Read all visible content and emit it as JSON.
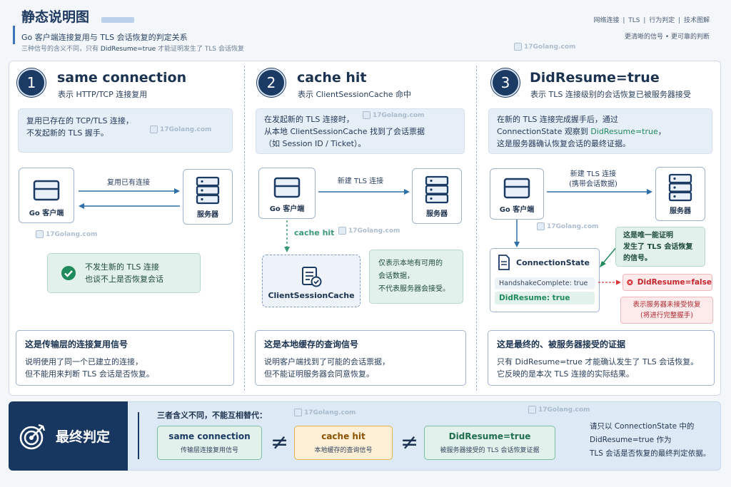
{
  "header": {
    "title": "静态说明图",
    "subtitle": "Go 客户端连接复用与 TLS 会话恢复的判定关系",
    "subnote_pre": "三种信号的含义不同，只有",
    "subnote_key": "DidResume=true",
    "subnote_post": "才能证明发生了 TLS 会话恢复",
    "tags": "网络连接 | TLS | 行为判定 | 技术图解",
    "tags2": "更清晰的信号   •   更可靠的判断"
  },
  "watermark": "17Golang.com",
  "columns": [
    {
      "num": "1",
      "title": "same connection",
      "subtitle": "表示 HTTP/TCP 连接复用",
      "desc_lines": [
        "复用已存在的 TCP/TLS 连接，",
        "不发起新的 TLS 握手。"
      ],
      "client_label": "Go 客户端",
      "server_label": "服务器",
      "arrow_label": "复用已有连接",
      "check_lines": [
        "不发生新的 TLS 连接",
        "也谈不上是否恢复会话"
      ],
      "bottom_title": "这是传输层的连接复用信号",
      "bottom_lines": [
        "说明使用了同一个已建立的连接，",
        "但不能用来判断 TLS 会话是否恢复。"
      ]
    },
    {
      "num": "2",
      "title": "cache hit",
      "subtitle": "表示 ClientSessionCache 命中",
      "desc_lines": [
        "在发起新的 TLS 连接时，",
        "从本地 ClientSessionCache 找到了会话票据",
        "（如 Session ID / Ticket）。"
      ],
      "client_label": "Go 客户端",
      "server_label": "服务器",
      "arrow_label": "新建 TLS 连接",
      "cache_hit_label": "cache hit",
      "cache_box_label": "ClientSessionCache",
      "note_lines": [
        "仅表示本地有可用的",
        "会话数据，",
        "不代表服务器会接受。"
      ],
      "bottom_title": "这是本地缓存的查询信号",
      "bottom_lines": [
        "说明客户端找到了可能的会话票据，",
        "但不能证明服务器会同意恢复。"
      ]
    },
    {
      "num": "3",
      "title": "DidResume=true",
      "subtitle": "表示 TLS 连接级别的会话恢复已被服务器接受",
      "desc_line1": "在新的 TLS 连接完成握手后，通过",
      "desc_line2_pre": "ConnectionState 观察到",
      "desc_line2_key": "DidResume=true",
      "desc_line2_post": "，",
      "desc_line3": "这是服务器确认恢复会话的最终证据。",
      "client_label": "Go 客户端",
      "server_label": "服务器",
      "arrow_label_1": "新建 TLS 连接",
      "arrow_label_2": "(携带会话数据)",
      "state_title": "ConnectionState",
      "state_row1": "HandshakeComplete: true",
      "state_row2": "DidResume: true",
      "proof_lines": [
        "这是唯一能证明",
        "发生了 TLS 会话恢复",
        "的信号。"
      ],
      "false_label": "DidResume=false",
      "false_note_lines": [
        "表示服务器未接受恢复",
        "(将进行完整握手)"
      ],
      "bottom_title": "这是最终的、被服务器接受的证据",
      "bottom_lines": [
        "只有 DidResume=true 才能确认发生了 TLS 会话恢复。",
        "它反映的是本次 TLS 连接的实际结果。"
      ]
    }
  ],
  "footer": {
    "verdict": "最终判定",
    "heading": "三者含义不同，不能互相替代：",
    "pills": [
      {
        "title": "same connection",
        "sub": "传输层连接复用信号"
      },
      {
        "title": "cache hit",
        "sub": "本地缓存的查询信号"
      },
      {
        "title": "DidResume=true",
        "sub": "被服务器接受的 TLS 会话恢复证据"
      }
    ],
    "neq": "≠",
    "conclusion_lines": [
      "请只以 ConnectionState 中的",
      "DidResume=true 作为",
      "TLS 会话是否恢复的最终判定依据。"
    ]
  },
  "colors": {
    "navy": "#1b3a64",
    "green": "#1f8a5b",
    "red": "#d9363e",
    "orange_pill": "#fdeed6"
  }
}
